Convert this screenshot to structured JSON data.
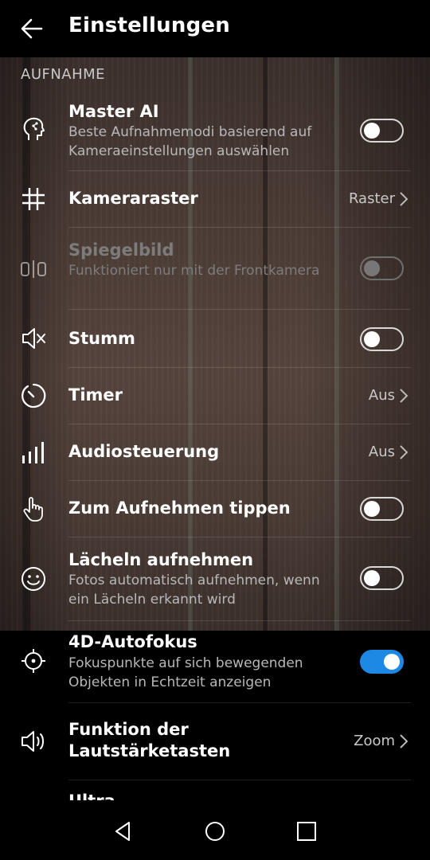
{
  "header": {
    "title": "Einstellungen",
    "back_icon": "arrow-left-icon"
  },
  "section": {
    "title": "AUFNAHME"
  },
  "settings": [
    {
      "id": "master-ai",
      "icon": "master-ai-icon",
      "label": "Master AI",
      "sub": "Beste Aufnahmemodi basierend auf Kameraeinstellungen auswählen",
      "control": "toggle",
      "on": false,
      "enabled": true
    },
    {
      "id": "kameraraster",
      "icon": "grid-icon",
      "label": "Kameraraster",
      "control": "value",
      "value": "Raster",
      "enabled": true
    },
    {
      "id": "spiegelbild",
      "icon": "mirror-icon",
      "label": "Spiegelbild",
      "sub": "Funktioniert nur mit der Frontkamera",
      "control": "toggle",
      "on": false,
      "enabled": false
    },
    {
      "id": "stumm",
      "icon": "speaker-muted-icon",
      "label": "Stumm",
      "control": "toggle",
      "on": false,
      "enabled": true
    },
    {
      "id": "timer",
      "icon": "timer-icon",
      "label": "Timer",
      "control": "value",
      "value": "Aus",
      "enabled": true
    },
    {
      "id": "audiosteuerung",
      "icon": "signal-bars-icon",
      "label": "Audiosteuerung",
      "control": "value",
      "value": "Aus",
      "enabled": true
    },
    {
      "id": "zum-aufnehmen-tippen",
      "icon": "touch-hand-icon",
      "label": "Zum Aufnehmen tippen",
      "control": "toggle",
      "on": false,
      "enabled": true
    },
    {
      "id": "laecheln-aufnehmen",
      "icon": "smiley-icon",
      "label": "Lächeln aufnehmen",
      "sub": "Fotos automatisch aufnehmen, wenn ein Lächeln erkannt wird",
      "control": "toggle",
      "on": false,
      "enabled": true
    },
    {
      "id": "4d-autofokus",
      "icon": "crosshair-icon",
      "label": "4D-Autofokus",
      "sub": "Fokuspunkte auf sich bewegenden Objekten in Echtzeit anzeigen",
      "control": "toggle",
      "on": true,
      "enabled": true
    },
    {
      "id": "lautstaerketasten",
      "icon": "speaker-icon",
      "label_line1": "Funktion der",
      "label_line2": "Lautstärketasten",
      "control": "value",
      "value": "Zoom",
      "enabled": true
    },
    {
      "id": "ultra",
      "label": "Ultra-",
      "partially_visible": true
    }
  ],
  "navbar": {
    "back": "nav-back-icon",
    "home": "nav-home-icon",
    "recents": "nav-recents-icon"
  },
  "colors": {
    "accent": "#1e88e5",
    "background": "#000000"
  }
}
